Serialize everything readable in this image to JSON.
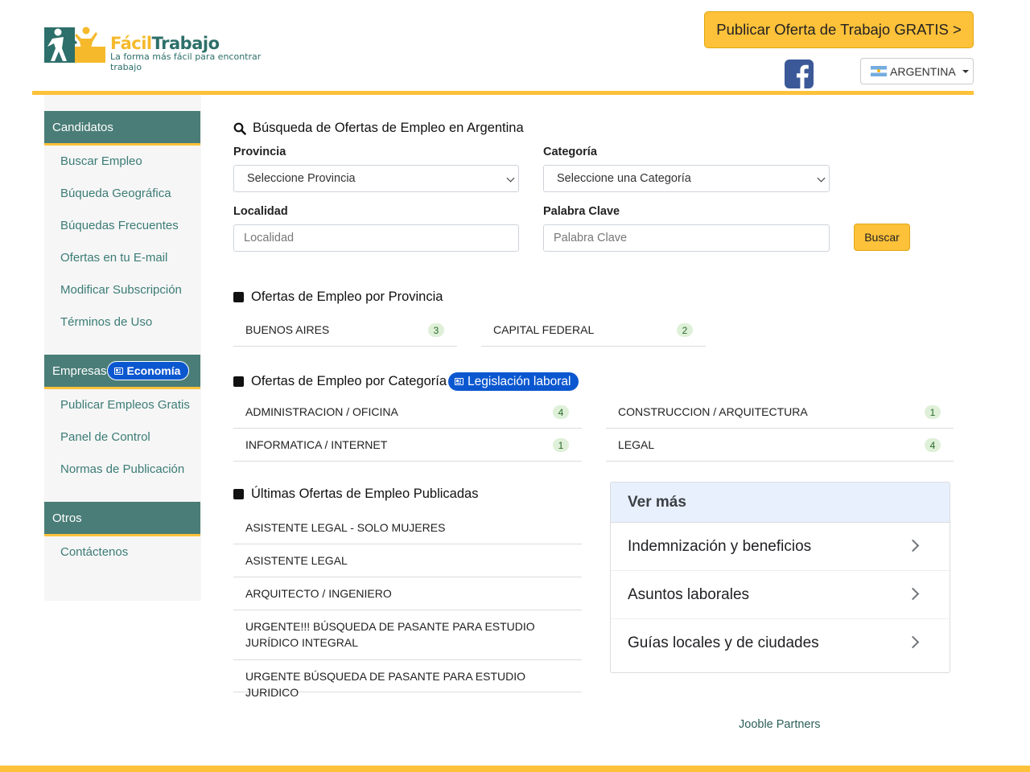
{
  "header": {
    "logo": {
      "name_part1": "Fácil",
      "name_part2": "Trabajo",
      "tagline": "La forma más fácil para encontrar trabajo"
    },
    "publish_button": "Publicar Oferta de Trabajo GRATIS >",
    "country": "ARGENTINA",
    "accent_color": "#fdc13a",
    "brand_color": "#4a7d77"
  },
  "sidebar": {
    "candidatos": {
      "title": "Candidatos",
      "links": [
        "Buscar Empleo",
        "Búqueda Geográfica",
        "Búquedas Frecuentes",
        "Ofertas en tu E-mail",
        "Modificar Subscripción",
        "Términos de Uso"
      ]
    },
    "empresas": {
      "title": "Empresas",
      "badge": "Economía",
      "links": [
        "Publicar Empleos Gratis",
        "Panel de Control",
        "Normas de Publicación"
      ]
    },
    "otros": {
      "title": "Otros",
      "links": [
        "Contáctenos"
      ]
    }
  },
  "search": {
    "title": "Búsqueda de Ofertas de Empleo en Argentina",
    "provincia_label": "Provincia",
    "provincia_value": "Seleccione Provincia",
    "categoria_label": "Categoría",
    "categoria_value": "Seleccione una Categoría",
    "localidad_label": "Localidad",
    "localidad_placeholder": "Localidad",
    "palabra_label": "Palabra Clave",
    "palabra_placeholder": "Palabra Clave",
    "button": "Buscar"
  },
  "by_province": {
    "title": "Ofertas de Empleo por Provincia",
    "items": [
      {
        "name": "BUENOS AIRES",
        "count": "3"
      },
      {
        "name": "CAPITAL FEDERAL",
        "count": "2"
      }
    ]
  },
  "by_category": {
    "title": "Ofertas de Empleo por Categoría",
    "badge": "Legislación laboral",
    "items": [
      {
        "name": "ADMINISTRACION / OFICINA",
        "count": "4"
      },
      {
        "name": "CONSTRUCCION / ARQUITECTURA",
        "count": "1"
      },
      {
        "name": "INFORMATICA / INTERNET",
        "count": "1"
      },
      {
        "name": "LEGAL",
        "count": "4"
      }
    ]
  },
  "latest": {
    "title": "Últimas Ofertas de Empleo Publicadas",
    "jobs": [
      "ASISTENTE LEGAL - SOLO MUJERES",
      "ASISTENTE LEGAL",
      "ARQUITECTO / INGENIERO",
      "URGENTE!!! BÚSQUEDA DE PASANTE PARA ESTUDIO JURÍDICO INTEGRAL",
      "URGENTE BÚSQUEDA DE PASANTE PARA ESTUDIO JURIDICO"
    ]
  },
  "ver_mas": {
    "title": "Ver más",
    "items": [
      "Indemnización y beneficios",
      "Asuntos laborales",
      "Guías locales y de ciudades"
    ]
  },
  "partners": "Jooble Partners"
}
